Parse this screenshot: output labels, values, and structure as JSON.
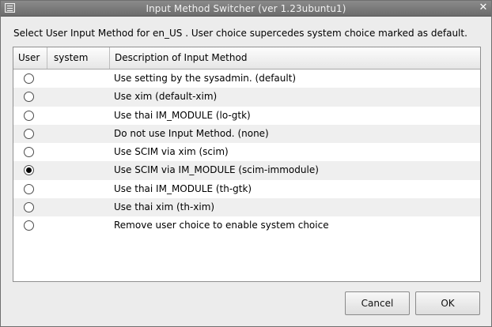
{
  "window": {
    "title": "Input Method Switcher (ver 1.23ubuntu1)",
    "menu_icon": "window-menu-icon",
    "close_icon": "close-icon",
    "close_glyph": "✕"
  },
  "instruction": "Select User Input Method for en_US . User choice supercedes system choice marked as default.",
  "table": {
    "headers": {
      "user": "User",
      "system": "system",
      "description": "Description of Input Method"
    },
    "rows": [
      {
        "user_selected": false,
        "system": "",
        "description": "Use setting by the sysadmin. (default)"
      },
      {
        "user_selected": false,
        "system": "",
        "description": "Use xim (default-xim)"
      },
      {
        "user_selected": false,
        "system": "",
        "description": "Use thai IM_MODULE (lo-gtk)"
      },
      {
        "user_selected": false,
        "system": "",
        "description": "Do not use Input Method. (none)"
      },
      {
        "user_selected": false,
        "system": "",
        "description": "Use SCIM via xim (scim)"
      },
      {
        "user_selected": true,
        "system": "",
        "description": "Use SCIM via IM_MODULE (scim-immodule)"
      },
      {
        "user_selected": false,
        "system": "",
        "description": "Use thai IM_MODULE (th-gtk)"
      },
      {
        "user_selected": false,
        "system": "",
        "description": "Use thai xim (th-xim)"
      },
      {
        "user_selected": false,
        "system": "",
        "description": "Remove user choice to enable system choice"
      }
    ]
  },
  "buttons": {
    "cancel": "Cancel",
    "ok": "OK"
  },
  "colors": {
    "titlebar": "#7b7b7b",
    "window_bg": "#ececec",
    "table_bg": "#ffffff",
    "alt_row": "#efefef"
  }
}
